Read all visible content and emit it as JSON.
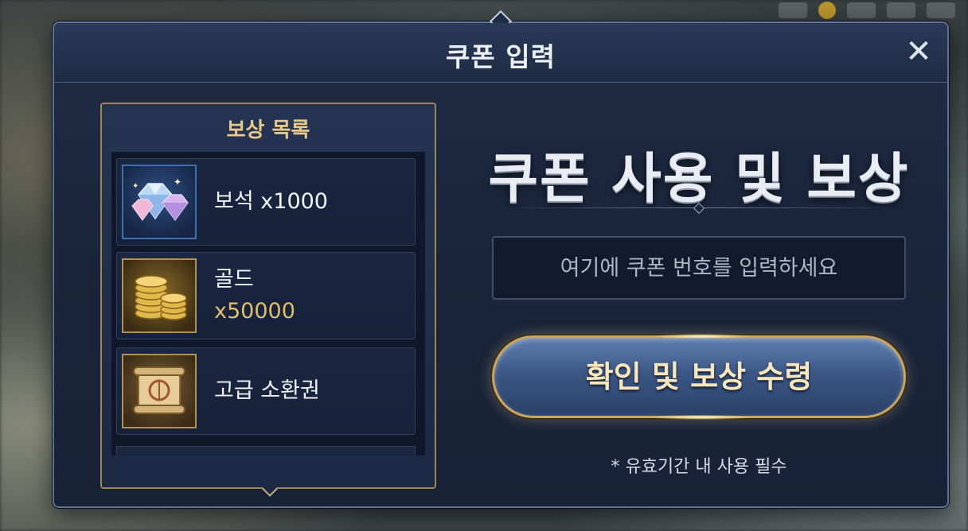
{
  "modal": {
    "title": "쿠폰 입력",
    "close_icon": "close-icon"
  },
  "rewards": {
    "title": "보상 목록",
    "items": [
      {
        "name": "보석",
        "quantity": "x1000",
        "icon": "gem-icon"
      },
      {
        "name": "골드",
        "quantity": "x50000",
        "icon": "gold-coins-icon"
      },
      {
        "name": "고급 소환권",
        "quantity": "",
        "icon": "summon-scroll-icon"
      }
    ]
  },
  "coupon": {
    "headline": "쿠폰 사용 및 보상",
    "input_placeholder": "여기에 쿠폰 번호를 입력하세요",
    "input_value": "",
    "confirm_label": "확인 및 보상 수령",
    "note": "* 유효기간 내 사용 필수"
  },
  "colors": {
    "accent_gold": "#c9a65e",
    "panel_bg": "#1f2c45",
    "text_gold": "#e8c98a"
  }
}
